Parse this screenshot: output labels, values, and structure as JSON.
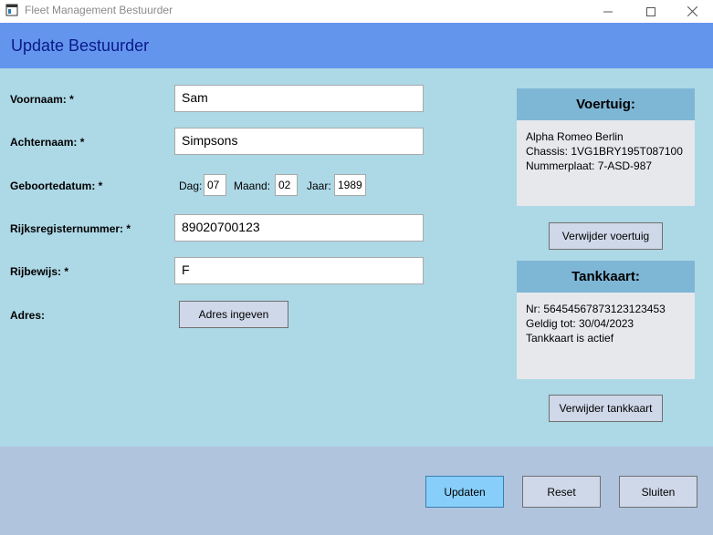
{
  "window": {
    "title": "Fleet Management Bestuurder"
  },
  "header": {
    "title": "Update Bestuurder"
  },
  "form": {
    "voornaam_label": "Voornaam: *",
    "voornaam_value": "Sam",
    "achternaam_label": "Achternaam: *",
    "achternaam_value": "Simpsons",
    "geboortedatum_label": "Geboortedatum: *",
    "dag_label": "Dag:",
    "dag_value": "07",
    "maand_label": "Maand:",
    "maand_value": "02",
    "jaar_label": "Jaar:",
    "jaar_value": "1989",
    "rijksregister_label": "Rijksregisternummer: *",
    "rijksregister_value": "89020700123",
    "rijbewijs_label": "Rijbewijs: *",
    "rijbewijs_value": "F",
    "adres_label": "Adres:",
    "adres_button": "Adres ingeven"
  },
  "voertuig": {
    "title": "Voertuig:",
    "lines": [
      "Alpha Romeo Berlin",
      "Chassis: 1VG1BRY195T087100",
      "Nummerplaat: 7-ASD-987"
    ],
    "remove_button": "Verwijder voertuig"
  },
  "tankkaart": {
    "title": "Tankkaart:",
    "lines": [
      "Nr: 56454567873123123453",
      "Geldig tot: 30/04/2023",
      "Tankkaart is actief"
    ],
    "remove_button": "Verwijder tankkaart"
  },
  "footer": {
    "update_button": "Updaten",
    "reset_button": "Reset",
    "close_button": "Sluiten"
  },
  "colors": {
    "header": "#6495ed",
    "main": "#add8e6",
    "footer": "#b0c4de",
    "panel_header": "#7eb6d6",
    "primary_button": "#87cefa"
  }
}
